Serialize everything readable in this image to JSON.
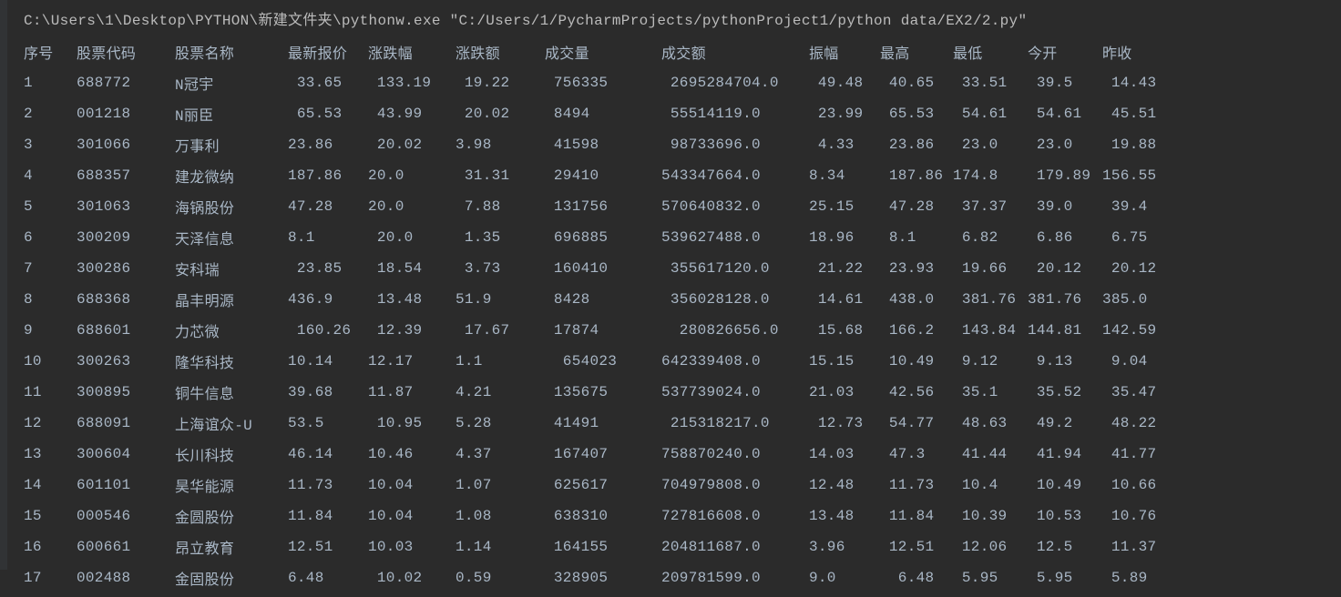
{
  "command_line": "C:\\Users\\1\\Desktop\\PYTHON\\新建文件夹\\pythonw.exe \"C:/Users/1/PycharmProjects/pythonProject1/python data/EX2/2.py\"",
  "headers": {
    "idx": "序号",
    "code": "股票代码",
    "name": "股票名称",
    "price": "最新报价",
    "pct": "涨跌幅",
    "chg": "涨跌额",
    "vol": "成交量",
    "amt": "成交额",
    "amp": "振幅",
    "high": "最高",
    "low": "最低",
    "open": "今开",
    "prev": "昨收"
  },
  "rows": [
    {
      "idx": "1",
      "code": "688772",
      "name": "N冠宇",
      "price": " 33.65",
      "pct": " 133.19",
      "chg": " 19.22",
      "vol": " 756335",
      "amt": " 2695284704.0",
      "amp": " 49.48",
      "high": " 40.65",
      "low": " 33.51",
      "open": " 39.5",
      "prev": " 14.43"
    },
    {
      "idx": "2",
      "code": "001218",
      "name": "N丽臣",
      "price": " 65.53",
      "pct": " 43.99",
      "chg": " 20.02",
      "vol": " 8494",
      "amt": " 55514119.0",
      "amp": " 23.99",
      "high": " 65.53",
      "low": " 54.61",
      "open": " 54.61",
      "prev": " 45.51"
    },
    {
      "idx": "3",
      "code": "301066",
      "name": "万事利",
      "price": "23.86",
      "pct": " 20.02",
      "chg": "3.98",
      "vol": " 41598",
      "amt": " 98733696.0",
      "amp": " 4.33",
      "high": " 23.86",
      "low": " 23.0",
      "open": " 23.0",
      "prev": " 19.88"
    },
    {
      "idx": "4",
      "code": "688357",
      "name": "建龙微纳",
      "price": "187.86",
      "pct": "20.0",
      "chg": " 31.31",
      "vol": " 29410",
      "amt": "543347664.0",
      "amp": "8.34",
      "high": " 187.86",
      "low": "174.8",
      "open": " 179.89",
      "prev": "156.55"
    },
    {
      "idx": "5",
      "code": "301063",
      "name": "海锅股份",
      "price": "47.28",
      "pct": "20.0",
      "chg": " 7.88",
      "vol": " 131756",
      "amt": "570640832.0",
      "amp": "25.15",
      "high": " 47.28",
      "low": " 37.37",
      "open": " 39.0",
      "prev": " 39.4"
    },
    {
      "idx": "6",
      "code": "300209",
      "name": "天泽信息",
      "price": "8.1",
      "pct": " 20.0",
      "chg": " 1.35",
      "vol": " 696885",
      "amt": "539627488.0",
      "amp": "18.96",
      "high": " 8.1",
      "low": " 6.82",
      "open": " 6.86",
      "prev": " 6.75"
    },
    {
      "idx": "7",
      "code": "300286",
      "name": "安科瑞",
      "price": " 23.85",
      "pct": " 18.54",
      "chg": " 3.73",
      "vol": " 160410",
      "amt": " 355617120.0",
      "amp": " 21.22",
      "high": " 23.93",
      "low": " 19.66",
      "open": " 20.12",
      "prev": " 20.12"
    },
    {
      "idx": "8",
      "code": "688368",
      "name": "晶丰明源",
      "price": "436.9",
      "pct": " 13.48",
      "chg": "51.9",
      "vol": " 8428",
      "amt": " 356028128.0",
      "amp": " 14.61",
      "high": " 438.0",
      "low": " 381.76",
      "open": "381.76",
      "prev": "385.0"
    },
    {
      "idx": "9",
      "code": "688601",
      "name": "力芯微",
      "price": " 160.26",
      "pct": " 12.39",
      "chg": " 17.67",
      "vol": " 17874",
      "amt": "  280826656.0",
      "amp": " 15.68",
      "high": " 166.2",
      "low": " 143.84",
      "open": "144.81",
      "prev": "142.59"
    },
    {
      "idx": "10",
      "code": "300263",
      "name": "隆华科技",
      "price": "10.14",
      "pct": "12.17",
      "chg": "1.1",
      "vol": "  654023",
      "amt": "642339408.0",
      "amp": "15.15",
      "high": " 10.49",
      "low": " 9.12",
      "open": " 9.13",
      "prev": " 9.04"
    },
    {
      "idx": "11",
      "code": "300895",
      "name": "铜牛信息",
      "price": "39.68",
      "pct": "11.87",
      "chg": "4.21",
      "vol": " 135675",
      "amt": "537739024.0",
      "amp": "21.03",
      "high": " 42.56",
      "low": " 35.1",
      "open": " 35.52",
      "prev": " 35.47"
    },
    {
      "idx": "12",
      "code": "688091",
      "name": "上海谊众-U",
      "price": "53.5",
      "pct": " 10.95",
      "chg": "5.28",
      "vol": " 41491",
      "amt": " 215318217.0",
      "amp": " 12.73",
      "high": " 54.77",
      "low": " 48.63",
      "open": " 49.2",
      "prev": " 48.22"
    },
    {
      "idx": "13",
      "code": "300604",
      "name": "长川科技",
      "price": "46.14",
      "pct": "10.46",
      "chg": "4.37",
      "vol": " 167407",
      "amt": "758870240.0",
      "amp": "14.03",
      "high": " 47.3",
      "low": " 41.44",
      "open": " 41.94",
      "prev": " 41.77"
    },
    {
      "idx": "14",
      "code": "601101",
      "name": "昊华能源",
      "price": "11.73",
      "pct": "10.04",
      "chg": "1.07",
      "vol": " 625617",
      "amt": "704979808.0",
      "amp": "12.48",
      "high": " 11.73",
      "low": " 10.4",
      "open": " 10.49",
      "prev": " 10.66"
    },
    {
      "idx": "15",
      "code": "000546",
      "name": "金圆股份",
      "price": "11.84",
      "pct": "10.04",
      "chg": "1.08",
      "vol": " 638310",
      "amt": "727816608.0",
      "amp": "13.48",
      "high": " 11.84",
      "low": " 10.39",
      "open": " 10.53",
      "prev": " 10.76"
    },
    {
      "idx": "16",
      "code": "600661",
      "name": "昂立教育",
      "price": "12.51",
      "pct": "10.03",
      "chg": "1.14",
      "vol": " 164155",
      "amt": "204811687.0",
      "amp": "3.96",
      "high": " 12.51",
      "low": " 12.06",
      "open": " 12.5",
      "prev": " 11.37"
    },
    {
      "idx": "17",
      "code": "002488",
      "name": "金固股份",
      "price": "6.48",
      "pct": " 10.02",
      "chg": "0.59",
      "vol": " 328905",
      "amt": "209781599.0",
      "amp": "9.0",
      "high": "  6.48",
      "low": " 5.95",
      "open": " 5.95",
      "prev": " 5.89"
    }
  ]
}
